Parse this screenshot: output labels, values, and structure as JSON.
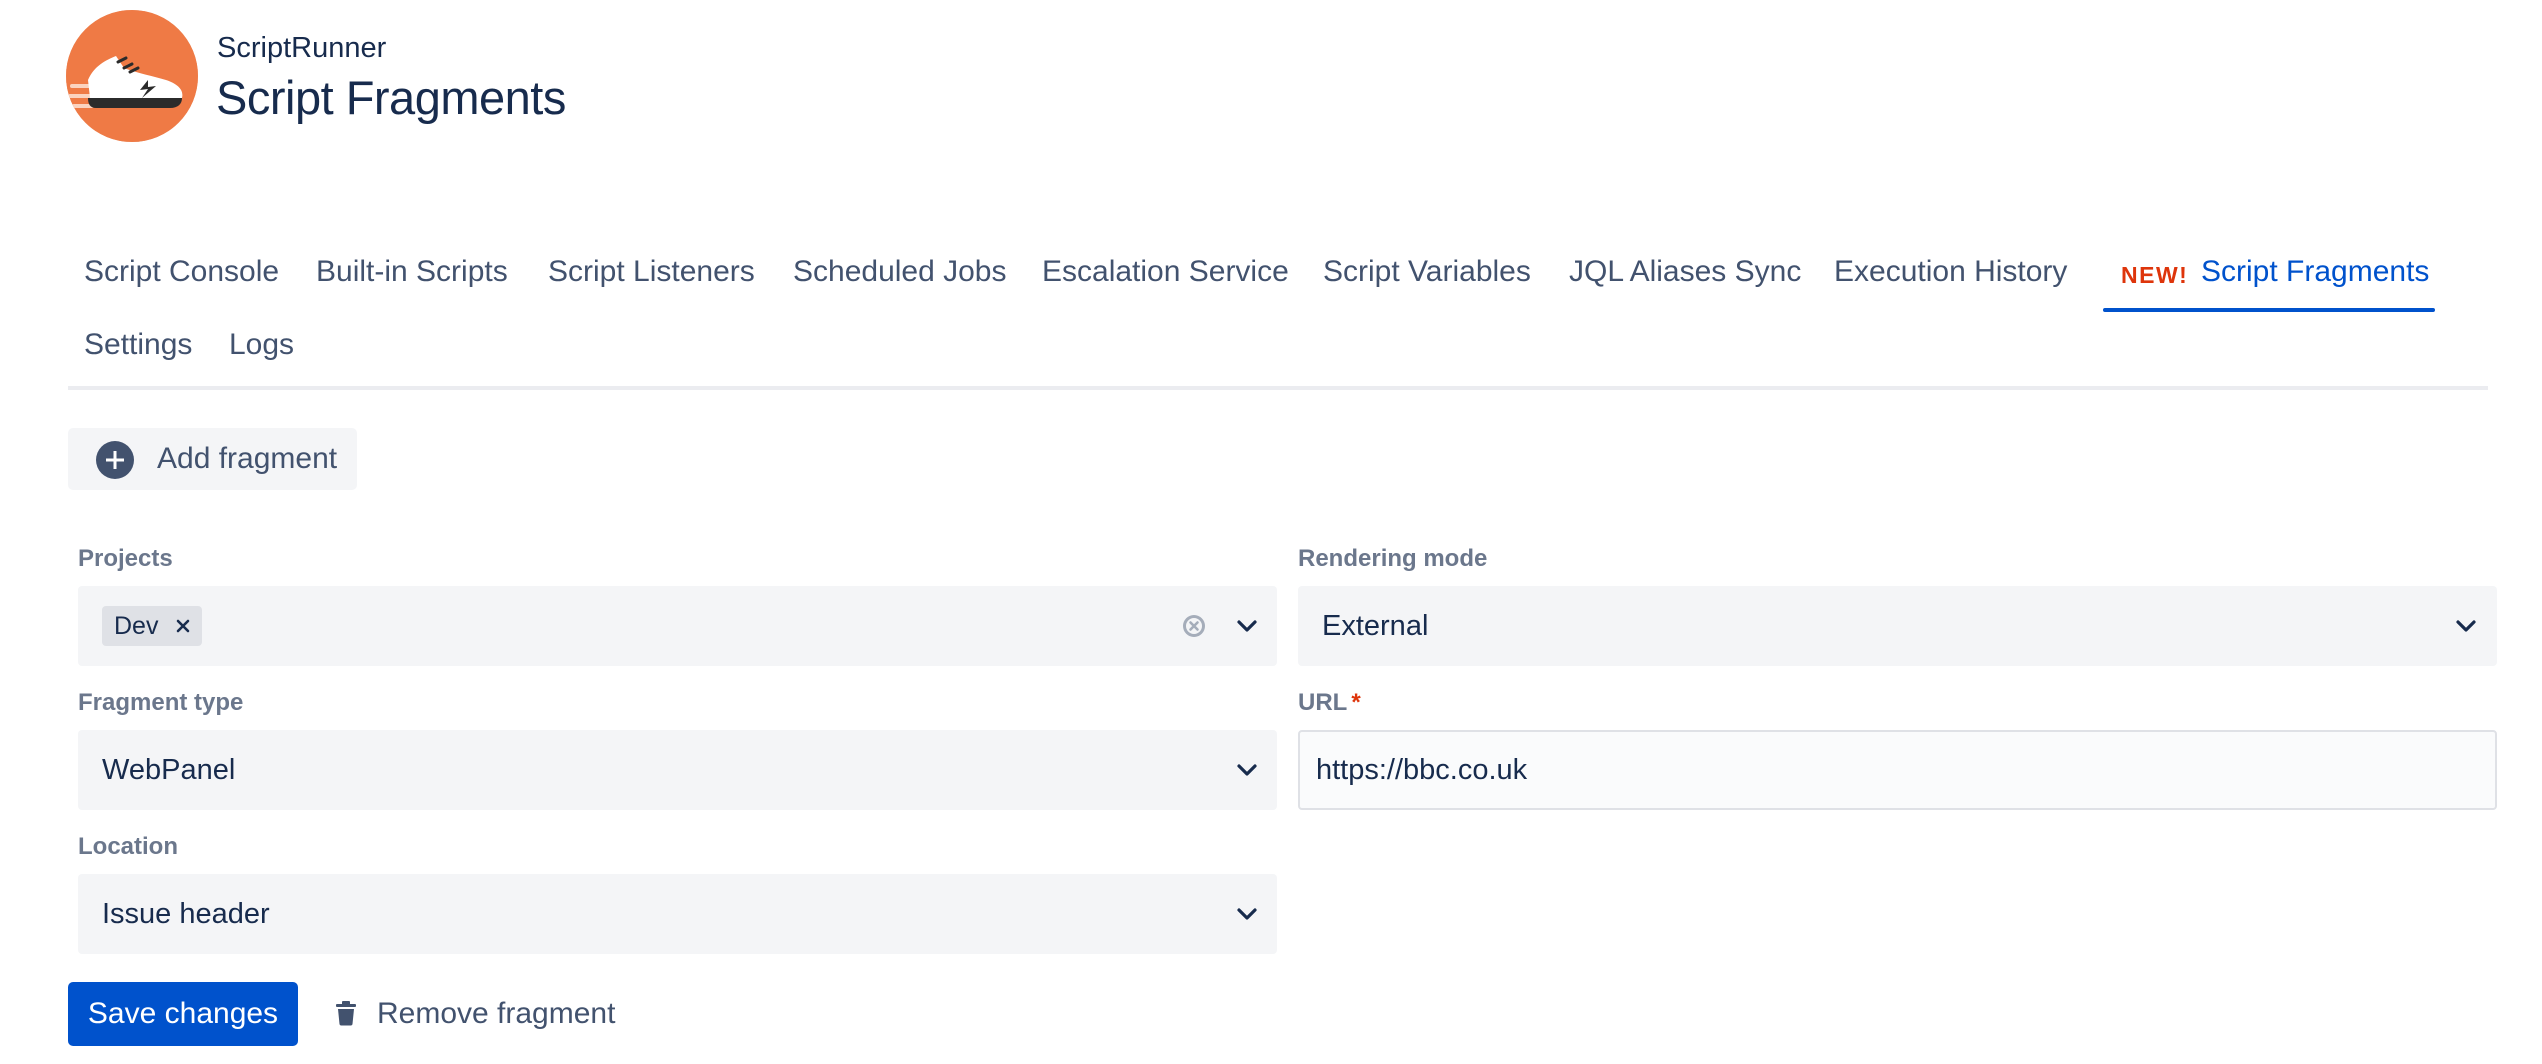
{
  "header": {
    "app_name": "ScriptRunner",
    "title": "Script Fragments",
    "logo_icon": "running-shoe-icon",
    "brand_color": "#ef7a45"
  },
  "tabs": [
    {
      "label": "Script Console",
      "active": false
    },
    {
      "label": "Built-in Scripts",
      "active": false
    },
    {
      "label": "Script Listeners",
      "active": false
    },
    {
      "label": "Scheduled Jobs",
      "active": false
    },
    {
      "label": "Escalation Service",
      "active": false
    },
    {
      "label": "Script Variables",
      "active": false
    },
    {
      "label": "JQL Aliases Sync",
      "active": false
    },
    {
      "label": "Execution History",
      "active": false
    },
    {
      "label": "Script Fragments",
      "active": true,
      "badge": "NEW!"
    },
    {
      "label": "Settings",
      "active": false
    },
    {
      "label": "Logs",
      "active": false
    }
  ],
  "add_fragment": {
    "label": "Add fragment",
    "icon": "add-circle-icon"
  },
  "form": {
    "projects": {
      "label": "Projects",
      "tags": [
        "Dev"
      ]
    },
    "rendering_mode": {
      "label": "Rendering mode",
      "value": "External"
    },
    "fragment_type": {
      "label": "Fragment type",
      "value": "WebPanel"
    },
    "url": {
      "label": "URL",
      "required_marker": "*",
      "value": "https://bbc.co.uk"
    },
    "location": {
      "label": "Location",
      "value": "Issue header"
    }
  },
  "actions": {
    "save_label": "Save changes",
    "remove_label": "Remove fragment"
  },
  "colors": {
    "primary": "#0052cc",
    "text": "#172b4d",
    "subtle_text": "#42526e",
    "label_text": "#6b778c",
    "field_bg": "#f4f5f7",
    "badge_new": "#de350b",
    "required": "#de350b"
  }
}
